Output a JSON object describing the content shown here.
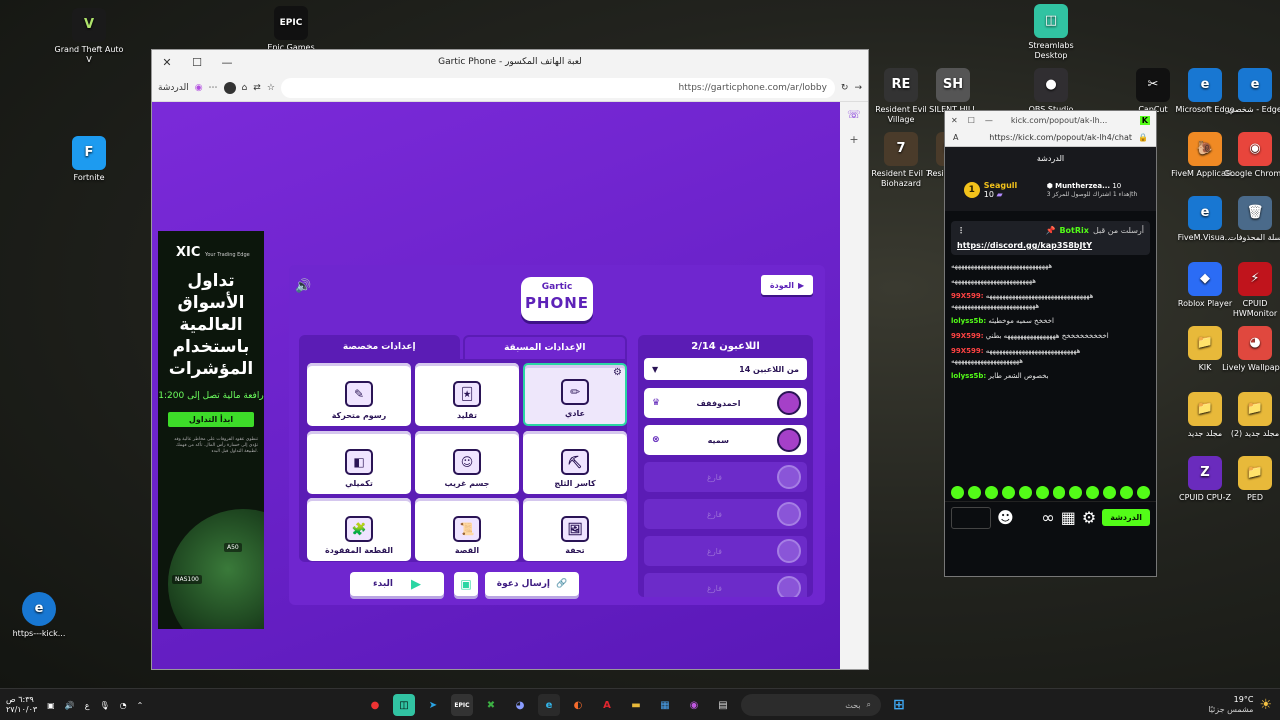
{
  "desktop": {
    "left_icons": [
      {
        "label": "Grand Theft Auto V",
        "glyph": "V",
        "color": "#1a1a1a"
      },
      {
        "label": "Epic Games",
        "glyph": "EPIC",
        "color": "#111111"
      },
      {
        "label": "Fortnite",
        "glyph": "F",
        "color": "#1d9bf0"
      },
      {
        "label": "https---kick...",
        "glyph": "e",
        "color": "#1877d2"
      }
    ],
    "right_icons": [
      {
        "label": "Streamlabs Desktop",
        "glyph": "◫",
        "color": "#31c3a2"
      },
      {
        "label": "Resident Evil Village",
        "glyph": "RE",
        "color": "#333333"
      },
      {
        "label": "SILENT HILL",
        "glyph": "SH",
        "color": "#555555"
      },
      {
        "label": "OBS Studio",
        "glyph": "●",
        "color": "#302e31"
      },
      {
        "label": "CapCut",
        "glyph": "✂",
        "color": "#111111"
      },
      {
        "label": "Microsoft Edge",
        "glyph": "e",
        "color": "#1877d2"
      },
      {
        "label": "شخصي - Edge",
        "glyph": "e",
        "color": "#1877d2"
      },
      {
        "label": "Resident Evil 7 Biohazard",
        "glyph": "7",
        "color": "#4a3b2a"
      },
      {
        "label": "Resident Evil Tom",
        "glyph": "RE",
        "color": "#4a3b2a"
      },
      {
        "label": "FiveM Applicati...",
        "glyph": "🐌",
        "color": "#f08a24"
      },
      {
        "label": "Google Chrome",
        "glyph": "◉",
        "color": "#e8453c"
      },
      {
        "label": "سلة المحذوفات",
        "glyph": "🗑",
        "color": "#4a6a8a"
      },
      {
        "label": "FiveM.Visua...",
        "glyph": "e",
        "color": "#1877d2"
      },
      {
        "label": "Roblox Player",
        "glyph": "◆",
        "color": "#2b6cf5"
      },
      {
        "label": "CPUID HWMonitor",
        "glyph": "⚡",
        "color": "#c0141c"
      },
      {
        "label": "KIK",
        "glyph": "📁",
        "color": "#e8b93a"
      },
      {
        "label": "Lively Wallpaper",
        "glyph": "◕",
        "color": "#e0483e"
      },
      {
        "label": "مجلد جديد",
        "glyph": "📁",
        "color": "#e8b93a"
      },
      {
        "label": "(2) مجلد جديد",
        "glyph": "📁",
        "color": "#e8b93a"
      },
      {
        "label": "CPUID CPU-Z",
        "glyph": "Z",
        "color": "#6a2bbd"
      },
      {
        "label": "PED",
        "glyph": "📁",
        "color": "#e8b93a"
      }
    ]
  },
  "browser": {
    "tab_title": "Gartic Phone - لعبة الهاتف المكسور",
    "url": "https://garticphone.com/ar/lobby",
    "chat_label": "الدردشة",
    "close_glyph": "✕",
    "max_glyph": "☐",
    "min_glyph": "—"
  },
  "ad": {
    "brand": "XIC",
    "tagline": "Your Trading Edge",
    "headline_lines": [
      "تداول",
      "الأسواق",
      "العالمية",
      "باستخدام",
      "المؤشرات"
    ],
    "sub": "رافعة مالية تصل إلى 1:200",
    "cta": "ابدأ التداول",
    "fine_print": "تنطوي عقود الفروقات على مخاطر عالية وقد تؤدي إلى خسارة رأس المال. تأكد من فهمك لطبيعة التداول قبل البدء.",
    "ticker_1": "A50",
    "ticker_2": "NAS100"
  },
  "game": {
    "back_label": "العودة",
    "logo_top": "Gartic",
    "logo_main": "PHONE",
    "tab_custom": "إعدادات مخصصة",
    "tab_preset": "الإعدادات المسبقة",
    "modes": [
      {
        "label": "رسوم متحركة",
        "icon": "✎"
      },
      {
        "label": "تقليد",
        "icon": "🃏"
      },
      {
        "label": "عادي",
        "icon": "✏",
        "active": true
      },
      {
        "label": "تكميلي",
        "icon": "◧"
      },
      {
        "label": "جسم غريب",
        "icon": "☺"
      },
      {
        "label": "كاسر الثلج",
        "icon": "⛏"
      },
      {
        "label": "القطعة المفقودة",
        "icon": "🧩"
      },
      {
        "label": "القصة",
        "icon": "📜"
      },
      {
        "label": "تحفة",
        "icon": "🖼"
      }
    ],
    "invite_label": "إرسال دعوة",
    "start_label": "البدء",
    "players_header": "اللاعبون 2/14",
    "max_players": "14 من اللاعبين",
    "slots": [
      {
        "name": "احمدوففف",
        "filled": true,
        "mark": "♛"
      },
      {
        "name": "سميه",
        "filled": true,
        "mark": "⊗"
      },
      {
        "name": "فارغ",
        "filled": false,
        "mark": ""
      },
      {
        "name": "فارغ",
        "filled": false,
        "mark": ""
      },
      {
        "name": "فارغ",
        "filled": false,
        "mark": ""
      },
      {
        "name": "فارغ",
        "filled": false,
        "mark": ""
      }
    ]
  },
  "kick": {
    "url": "https://kick.com/popout/ak-lh4/chat",
    "tab_url": "kick.com/popout/ak-lh...",
    "title": "الدردشة",
    "gift_1_user": "Seagull",
    "gift_1_count": "10",
    "gift_1_rank": "1",
    "gift_2_user": "Muntherzea...",
    "gift_2_count": "10",
    "gift_2_note": "إهداء 1 اشتراك للوصول للمركز 3th",
    "pinned_by": "أرسلت من قبل",
    "pinned_user": "BotRix",
    "pinned_link": "https://discord.gg/kap3S8bJtY",
    "messages": [
      {
        "user": "",
        "text": "ههههههههههههههههههههههههههههههه"
      },
      {
        "user": "",
        "text": "هههههههههههههههههههههههههه"
      },
      {
        "user": "99X599:",
        "text": "ههههههههههههههههههههههههههههههههه ههههههههههههههههههههههههههه"
      },
      {
        "user": "lolyss5b:",
        "text": "اخخخخ سميه موخطيئه"
      },
      {
        "user": "99X599:",
        "text": "اخخخخخخخخخخ ههههههههههههههههه بطني"
      },
      {
        "user": "99X599:",
        "text": "ههههههههههههههههههههههههههههه هههههههههههههههههههههه"
      },
      {
        "user": "lolyss5b:",
        "text": "بخصوص الشعر طاير"
      }
    ],
    "chat_button": "الدردشة"
  },
  "taskbar": {
    "search_placeholder": "بحث",
    "weather": "19°C",
    "weather_desc": "مشمس جزئيًا",
    "time": "٦:٣٩ ص",
    "date": "٢٧/١٠/٠٣",
    "lang": "ع"
  }
}
